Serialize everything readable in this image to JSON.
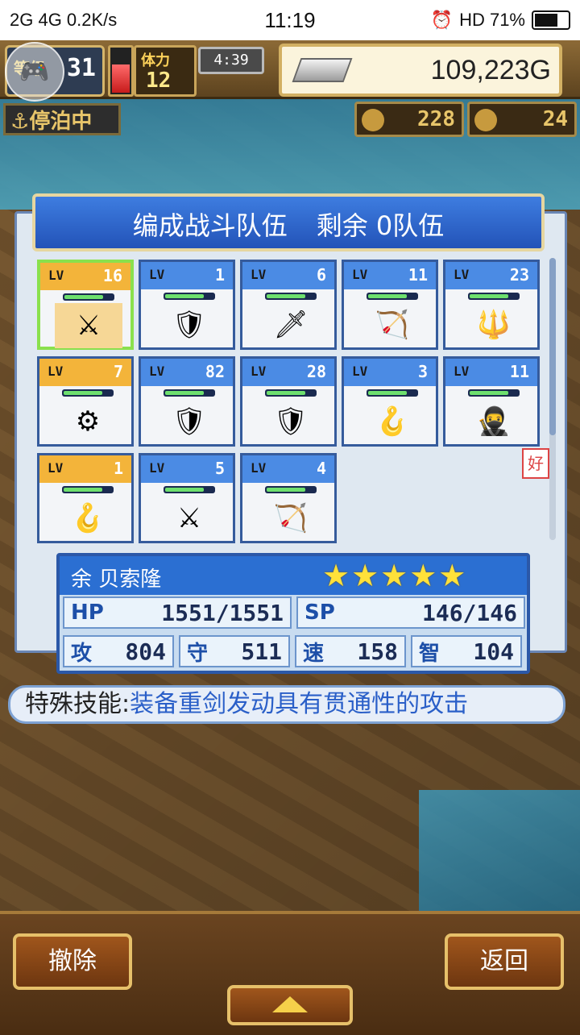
{
  "status_bar": {
    "left": "2G 4G 0.2K/s",
    "time": "11:19",
    "right": "HD 71%"
  },
  "hud": {
    "level_label": "等级",
    "level_value": "31",
    "stamina_label": "体力",
    "stamina_value": "12",
    "timer": "4:39",
    "gold": "109,223G",
    "anchor_status": "停泊中",
    "resource1": "228",
    "resource2": "24"
  },
  "panel": {
    "title_left": "编成战斗队伍",
    "title_right": "剩余 0队伍",
    "side_tab": "好",
    "lv_prefix": "LV",
    "cards": [
      {
        "lv": "16",
        "icon": "⚔",
        "gold": true,
        "selected": true
      },
      {
        "lv": "1",
        "icon": "🛡",
        "gold": false
      },
      {
        "lv": "6",
        "icon": "🗡",
        "gold": false
      },
      {
        "lv": "11",
        "icon": "🏹",
        "gold": false
      },
      {
        "lv": "23",
        "icon": "🔱",
        "gold": false
      },
      {
        "lv": "7",
        "icon": "⚙",
        "gold": true
      },
      {
        "lv": "82",
        "icon": "🛡",
        "gold": false
      },
      {
        "lv": "28",
        "icon": "🛡",
        "gold": false
      },
      {
        "lv": "3",
        "icon": "🪝",
        "gold": false
      },
      {
        "lv": "11",
        "icon": "🥷",
        "gold": false
      },
      {
        "lv": "1",
        "icon": "🪝",
        "gold": true
      },
      {
        "lv": "5",
        "icon": "⚔",
        "gold": false
      },
      {
        "lv": "4",
        "icon": "🏹",
        "gold": false
      }
    ]
  },
  "stats": {
    "name": "余 贝索隆",
    "stars": "★★★★★",
    "hp_label": "HP",
    "hp_value": "1551/1551",
    "sp_label": "SP",
    "sp_value": "146/146",
    "atk_label": "攻",
    "atk_value": "804",
    "def_label": "守",
    "def_value": "511",
    "spd_label": "速",
    "spd_value": "158",
    "int_label": "智",
    "int_value": "104"
  },
  "skill": {
    "label": "特殊技能:",
    "text": "装备重剑发动具有贯通性的攻击"
  },
  "bottom": {
    "remove": "撤除",
    "back": "返回"
  }
}
